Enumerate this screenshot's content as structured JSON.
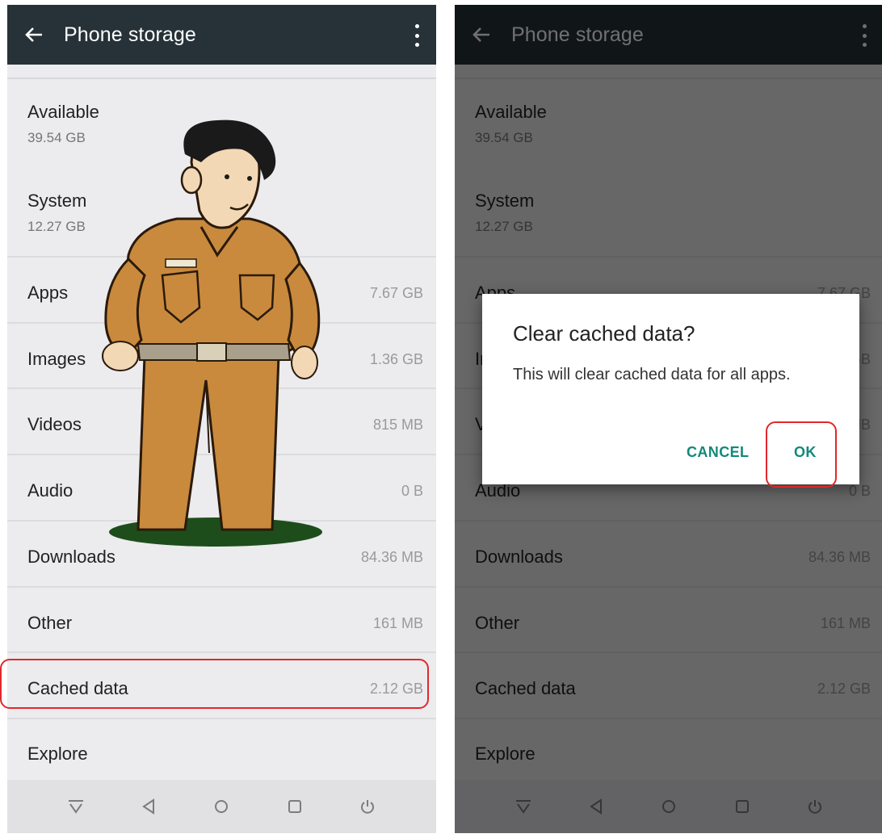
{
  "app": {
    "title": "Phone storage",
    "icons": {
      "back": "arrow-left-icon",
      "more": "overflow-menu-icon"
    }
  },
  "storage": {
    "available": {
      "label": "Available",
      "value": "39.54 GB"
    },
    "system": {
      "label": "System",
      "value": "12.27 GB"
    },
    "items": [
      {
        "label": "Apps",
        "value": "7.67 GB"
      },
      {
        "label": "Images",
        "value": "1.36 GB"
      },
      {
        "label": "Videos",
        "value": "815 MB"
      },
      {
        "label": "Audio",
        "value": "0 B"
      },
      {
        "label": "Downloads",
        "value": "84.36 MB"
      },
      {
        "label": "Other",
        "value": "161 MB"
      },
      {
        "label": "Cached data",
        "value": "2.12 GB"
      },
      {
        "label": "Explore",
        "value": ""
      }
    ]
  },
  "dialog": {
    "title": "Clear cached data?",
    "message": "This will clear cached data for all apps.",
    "cancel": "CANCEL",
    "ok": "OK"
  },
  "navbar": {
    "icons": [
      "hide-bar-icon",
      "back-triangle-icon",
      "home-circle-icon",
      "recents-square-icon",
      "power-icon"
    ]
  },
  "colors": {
    "appbar": "#263238",
    "background": "#ecebed",
    "accent": "#12897a",
    "highlight": "#e0282b"
  }
}
